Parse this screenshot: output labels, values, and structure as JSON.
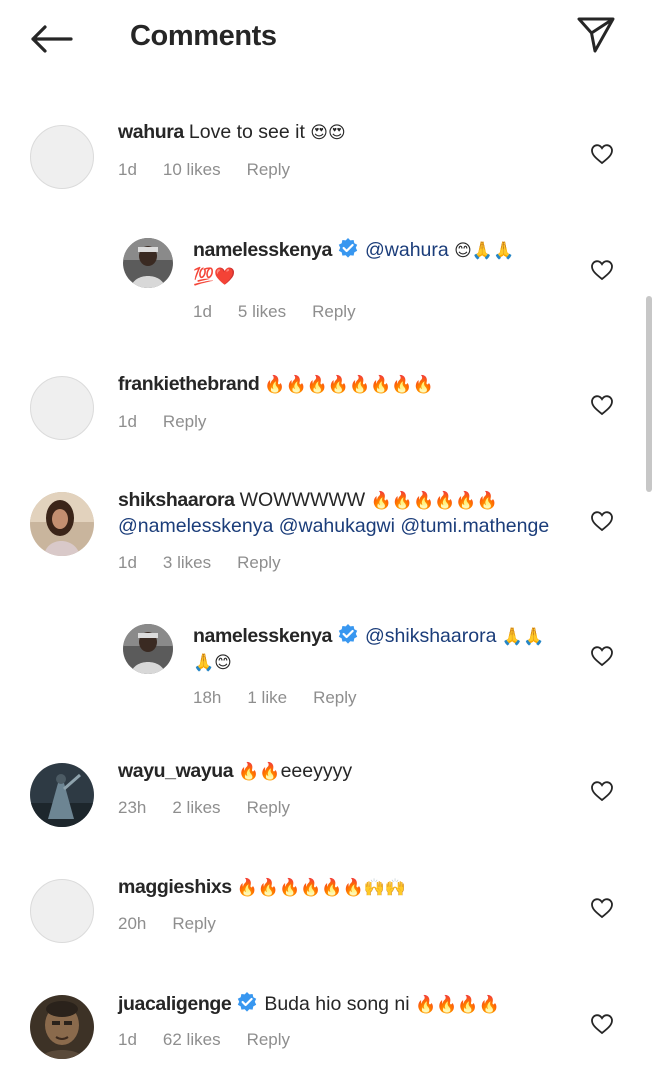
{
  "header": {
    "title": "Comments"
  },
  "comments": [
    {
      "username": "wahura",
      "text": "Love to see it",
      "emojis": "😍😍",
      "time": "1d",
      "likes": "10 likes",
      "reply": "Reply"
    },
    {
      "username": "namelesskenya",
      "mention": "@wahura",
      "emojis": "😊🙏🙏",
      "emojis2": "💯❤️",
      "time": "1d",
      "likes": "5 likes",
      "reply": "Reply"
    },
    {
      "username": "frankiethebrand",
      "emojis": "🔥🔥🔥🔥🔥🔥🔥🔥",
      "time": "1d",
      "reply": "Reply"
    },
    {
      "username": "shikshaarora",
      "text": "WOWWWWW",
      "emojis": "🔥🔥🔥🔥🔥🔥",
      "mentions": "@namelesskenya @wahukagwi @tumi.mathenge",
      "time": "1d",
      "likes": "3 likes",
      "reply": "Reply"
    },
    {
      "username": "namelesskenya",
      "mention": "@shikshaarora",
      "emojis": "🙏🙏",
      "emojis2": "🙏😊",
      "time": "18h",
      "likes": "1 like",
      "reply": "Reply"
    },
    {
      "username": "wayu_wayua",
      "emojis": "🔥🔥",
      "text": "eeeyyyy",
      "time": "23h",
      "likes": "2 likes",
      "reply": "Reply"
    },
    {
      "username": "maggieshixs",
      "emojis": "🔥🔥🔥🔥🔥🔥🙌🙌",
      "time": "20h",
      "reply": "Reply"
    },
    {
      "username": "juacaligenge",
      "text": "Buda hio song ni",
      "emojis": "🔥🔥🔥🔥",
      "time": "1d",
      "likes": "62 likes",
      "reply": "Reply"
    }
  ]
}
